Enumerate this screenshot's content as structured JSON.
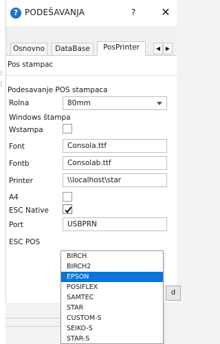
{
  "window": {
    "icon": "help-icon",
    "title": "PODEŠAVANJA",
    "help_label": "?",
    "close_label": "✕"
  },
  "tabs": [
    {
      "label": "Osnovno",
      "active": false
    },
    {
      "label": "DataBase",
      "active": false
    },
    {
      "label": "PosPrinter",
      "active": true
    }
  ],
  "tab_scroll": {
    "left": "◀",
    "right": "▶"
  },
  "panel": {
    "section_title": "Pos stampac",
    "group_title": "Podesavanje POS stampaca",
    "rolna": {
      "label": "Rolna",
      "value": "80mm"
    },
    "windows_title": "Windows štampa",
    "wstampa": {
      "label": "Wstampa",
      "checked": false
    },
    "font": {
      "label": "Font",
      "value": "Consola.ttf"
    },
    "fontb": {
      "label": "Fontb",
      "value": "Consolab.ttf"
    },
    "printer": {
      "label": "Printer",
      "value": "\\\\localhost\\star"
    },
    "a4": {
      "label": "A4",
      "checked": false
    },
    "esc_native": {
      "label": "ESC Native",
      "checked": true
    },
    "port": {
      "label": "Port",
      "value": "USBPRN"
    },
    "esc_pos": {
      "label": "ESC POS"
    }
  },
  "dropdown": {
    "options": [
      "BIRCH",
      "BIRCH2",
      "EPSON",
      "POSIFLEX",
      "SAMTEC",
      "STAR",
      "CUSTOM-S",
      "SEIKO-S",
      "STAR-S"
    ],
    "selected": "EPSON"
  }
}
